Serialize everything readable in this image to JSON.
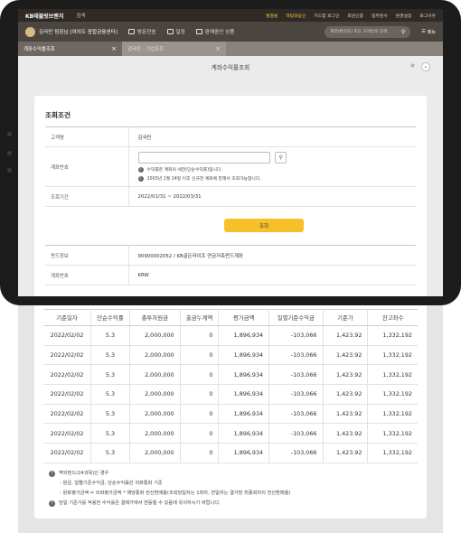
{
  "app": {
    "logo": "KB태블릿브랜치",
    "top_menu": "검색",
    "top_links": [
      "월결울",
      "액팅와승인",
      "키드함 로그인",
      "회원인증",
      "업무문서",
      "환경설정",
      "로그아웃"
    ]
  },
  "user": {
    "name_line": "김국민 팀장님 [여의도 종합금융센터]",
    "buttons": [
      "방문전송",
      "일정",
      "판매중인 상품"
    ],
    "search_placeholder": "화면(판번호) 또는 고객번호 검색",
    "menu_label": "메뉴"
  },
  "tabs": [
    {
      "label": "계좌수익률조회",
      "active": true
    },
    {
      "label": "검국민 - 기업조회",
      "active": false
    }
  ],
  "page": {
    "title": "계좌수익률조회"
  },
  "conditions": {
    "heading": "조회조건",
    "customer_label": "고객명",
    "customer_value": "김국민",
    "account_label": "계좌번호",
    "account_value": "",
    "hint1": "수익률은 계좌의 세전(단순수익률)입니다.",
    "hint2": "2003년 1월 24일 이후 신규한 계좌에 한해서 조회가능합니다.",
    "period_label": "조회기간",
    "period_value": "2022/01/31 ~ 2022/03/31",
    "query_button": "조회"
  },
  "info": {
    "fund_label": "펀드정보",
    "fund_value": "90900002052 / KB골든라이프 연금저축펀드계좌",
    "acct_label": "계좌번호",
    "acct_value": "KRW"
  },
  "results": {
    "headers": [
      "기준일자",
      "단순수익률",
      "총투자원금",
      "출금누계액",
      "평가금액",
      "일별기준수익금",
      "기준가",
      "잔고좌수"
    ],
    "rows": [
      [
        "2022/02/02",
        "5.3",
        "2,000,000",
        "0",
        "1,896,934",
        "-103,066",
        "1,423.92",
        "1,332,192"
      ],
      [
        "2022/02/02",
        "5.3",
        "2,000,000",
        "0",
        "1,896,934",
        "-103,066",
        "1,423.92",
        "1,332,192"
      ],
      [
        "2022/02/02",
        "5.3",
        "2,000,000",
        "0",
        "1,896,934",
        "-103,066",
        "1,423.92",
        "1,332,192"
      ],
      [
        "2022/02/02",
        "5.3",
        "2,000,000",
        "0",
        "1,896,934",
        "-103,066",
        "1,423.92",
        "1,332,192"
      ],
      [
        "2022/02/02",
        "5.3",
        "2,000,000",
        "0",
        "1,896,934",
        "-103,066",
        "1,423.92",
        "1,332,192"
      ],
      [
        "2022/02/02",
        "5.3",
        "2,000,000",
        "0",
        "1,896,934",
        "-103,066",
        "1,423.92",
        "1,332,192"
      ],
      [
        "2022/02/02",
        "5.3",
        "2,000,000",
        "0",
        "1,896,934",
        "-103,066",
        "1,423.92",
        "1,332,192"
      ]
    ]
  },
  "notes": {
    "n1": "역외펀드(24과목)인 경우",
    "n1a": "- 원금, 일별기준수익금, 단순수익률은 외화통화 기준",
    "n1b": "- 원화평가금액 = 외화평가금액 * 매당통화 전산환매율(조회당일자는 1좌자, 전일자는 결가방 최종회차의 전산환매율)",
    "n2": "당일 기준가를 적용한 수익률은 결제가에서 변동될 수 있음에 유의하시기 바랍니다."
  },
  "colors": {
    "accent": "#f6c02b",
    "topbar": "#2f2a26",
    "userbar": "#4b4540",
    "tabbar": "#8a837c"
  }
}
